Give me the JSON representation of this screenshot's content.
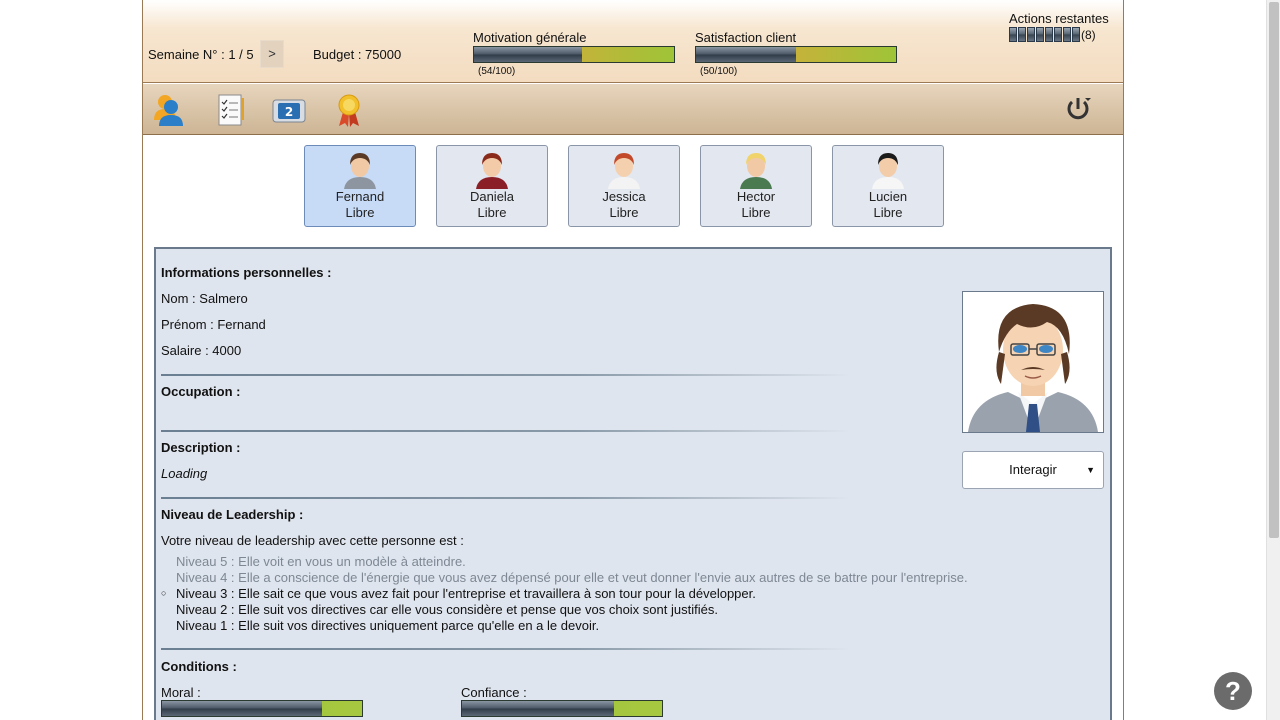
{
  "header": {
    "week_label": "Semaine N° : 1 / 5",
    "next_label": ">",
    "budget_label": "Budget : 75000",
    "motivation": {
      "label": "Motivation générale",
      "value_text": "(54/100)",
      "value": 54,
      "max": 100
    },
    "satisfaction": {
      "label": "Satisfaction client",
      "value_text": "(50/100)",
      "value": 50,
      "max": 100
    },
    "actions": {
      "label": "Actions restantes",
      "count_text": "(8)",
      "remaining": 8
    }
  },
  "toolbar": {
    "icons": [
      "team-icon",
      "checklist-icon",
      "calendar-icon",
      "award-icon",
      "power-icon"
    ]
  },
  "employees": [
    {
      "name": "Fernand",
      "status": "Libre",
      "active": true
    },
    {
      "name": "Daniela",
      "status": "Libre",
      "active": false
    },
    {
      "name": "Jessica",
      "status": "Libre",
      "active": false
    },
    {
      "name": "Hector",
      "status": "Libre",
      "active": false
    },
    {
      "name": "Lucien",
      "status": "Libre",
      "active": false
    }
  ],
  "details": {
    "personal_title": "Informations personnelles :",
    "nom": "Nom : Salmero",
    "prenom": "Prénom : Fernand",
    "salaire": "Salaire : 4000",
    "occupation_title": "Occupation :",
    "description_title": "Description :",
    "description_text": "Loading",
    "leadership_title": "Niveau de Leadership :",
    "leadership_intro": "Votre niveau de leadership avec cette personne est :",
    "levels": [
      "Niveau 5 : Elle voit en vous un modèle à atteindre.",
      "Niveau 4 : Elle a conscience de l'énergie que vous avez dépensé pour elle et veut donner l'envie aux autres de se battre pour l'entreprise.",
      "Niveau 3 : Elle sait ce que vous avez fait pour l'entreprise et travaillera à son tour pour la développer.",
      "Niveau 2 : Elle suit vos directives car elle vous considère et pense que vos choix sont justifiés.",
      "Niveau 1 : Elle suit vos directives uniquement parce qu'elle en a le devoir."
    ],
    "current_level": 3,
    "conditions_title": "Conditions :",
    "moral_label": "Moral :",
    "moral_level": 0.8,
    "confiance_label": "Confiance :",
    "confiance_level": 0.76,
    "interact_label": "Interagir"
  },
  "help_label": "?"
}
